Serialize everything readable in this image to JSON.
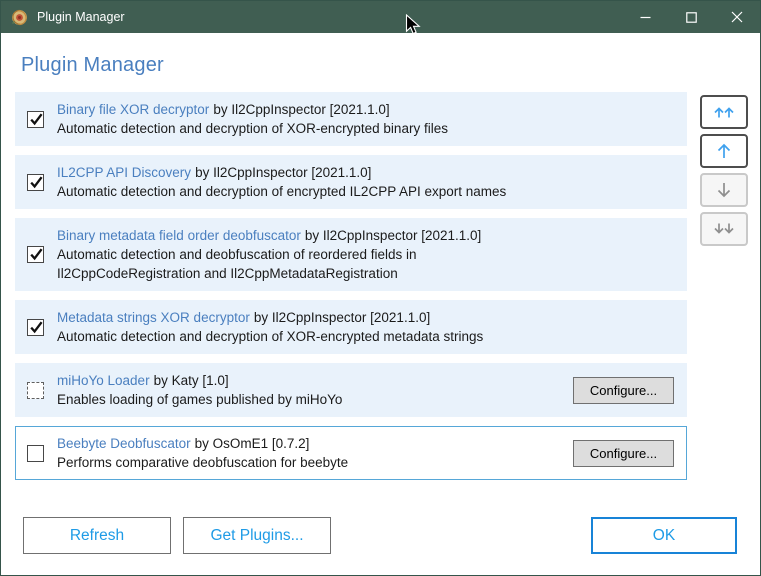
{
  "window": {
    "title": "Plugin Manager"
  },
  "titlebar": {
    "icon": "rose-app-icon",
    "controls": [
      {
        "name": "minimize-button",
        "icon": "minimize-icon"
      },
      {
        "name": "maximize-button",
        "icon": "maximize-icon"
      },
      {
        "name": "close-button",
        "icon": "close-icon"
      }
    ]
  },
  "heading": "Plugin Manager",
  "plugins": [
    {
      "name": "Binary file XOR decryptor",
      "byline": "by Il2CppInspector [2021.1.0]",
      "description": "Automatic detection and decryption of XOR-encrypted binary files",
      "checkbox": "checked",
      "has_configure": false,
      "selected": false
    },
    {
      "name": "IL2CPP API Discovery",
      "byline": "by Il2CppInspector [2021.1.0]",
      "description": "Automatic detection and decryption of encrypted IL2CPP API export names",
      "checkbox": "checked",
      "has_configure": false,
      "selected": false
    },
    {
      "name": "Binary metadata field order deobfuscator",
      "byline": "by Il2CppInspector [2021.1.0]",
      "description": "Automatic detection and deobfuscation of reordered fields in\nIl2CppCodeRegistration and Il2CppMetadataRegistration",
      "checkbox": "checked",
      "has_configure": false,
      "selected": false
    },
    {
      "name": "Metadata strings XOR decryptor",
      "byline": "by Il2CppInspector [2021.1.0]",
      "description": "Automatic detection and decryption of XOR-encrypted metadata strings",
      "checkbox": "checked",
      "has_configure": false,
      "selected": false
    },
    {
      "name": "miHoYo Loader",
      "byline": "by Katy [1.0]",
      "description": "Enables loading of games published by miHoYo",
      "checkbox": "dashed",
      "has_configure": true,
      "selected": false
    },
    {
      "name": "Beebyte Deobfuscator",
      "byline": "by OsOmE1 [0.7.2]",
      "description": "Performs comparative deobfuscation for beebyte",
      "checkbox": "unchecked",
      "has_configure": true,
      "selected": true
    }
  ],
  "configure_label": "Configure...",
  "move_buttons": [
    {
      "name": "move-to-top-button",
      "icon": "double-up-arrow-icon",
      "enabled": true
    },
    {
      "name": "move-up-button",
      "icon": "up-arrow-icon",
      "enabled": true
    },
    {
      "name": "move-down-button",
      "icon": "down-arrow-icon",
      "enabled": false
    },
    {
      "name": "move-to-bottom-button",
      "icon": "double-down-arrow-icon",
      "enabled": false
    }
  ],
  "footer": {
    "refresh": "Refresh",
    "get_plugins": "Get Plugins...",
    "ok": "OK"
  },
  "colors": {
    "titlebar": "#405e52",
    "heading": "#4a7fbf",
    "link": "#4a7fbf",
    "row_bg": "#e9f2fb",
    "selected_border": "#56a7d8",
    "accent_blue": "#1e9be6",
    "ok_border": "#1883d7",
    "arrow_blue": "#3fa1ee"
  }
}
